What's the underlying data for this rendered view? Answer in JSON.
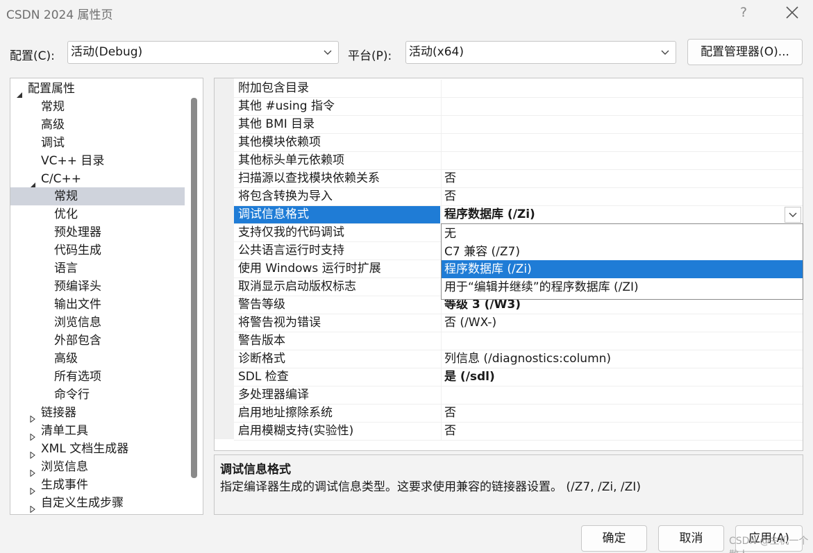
{
  "window": {
    "title": "CSDN 2024 属性页",
    "help": "?"
  },
  "toolbar": {
    "config_label": "配置(C):",
    "config_value": "活动(Debug)",
    "platform_label": "平台(P):",
    "platform_value": "活动(x64)",
    "config_manager": "配置管理器(O)..."
  },
  "tree": {
    "items": [
      {
        "label": "配置属性"
      },
      {
        "label": "常规"
      },
      {
        "label": "高级"
      },
      {
        "label": "调试"
      },
      {
        "label": "VC++ 目录"
      },
      {
        "label": "C/C++"
      },
      {
        "label": "常规"
      },
      {
        "label": "优化"
      },
      {
        "label": "预处理器"
      },
      {
        "label": "代码生成"
      },
      {
        "label": "语言"
      },
      {
        "label": "预编译头"
      },
      {
        "label": "输出文件"
      },
      {
        "label": "浏览信息"
      },
      {
        "label": "外部包含"
      },
      {
        "label": "高级"
      },
      {
        "label": "所有选项"
      },
      {
        "label": "命令行"
      },
      {
        "label": "链接器"
      },
      {
        "label": "清单工具"
      },
      {
        "label": "XML 文档生成器"
      },
      {
        "label": "浏览信息"
      },
      {
        "label": "生成事件"
      },
      {
        "label": "自定义生成步骤"
      }
    ]
  },
  "properties": [
    {
      "name": "附加包含目录",
      "value": ""
    },
    {
      "name": "其他 #using 指令",
      "value": ""
    },
    {
      "name": "其他 BMI 目录",
      "value": ""
    },
    {
      "name": "其他模块依赖项",
      "value": ""
    },
    {
      "name": "其他标头单元依赖项",
      "value": ""
    },
    {
      "name": "扫描源以查找模块依赖关系",
      "value": "否"
    },
    {
      "name": "将包含转换为导入",
      "value": "否"
    },
    {
      "name": "调试信息格式",
      "value": "程序数据库 (/Zi)"
    },
    {
      "name": "支持仅我的代码调试",
      "value": ""
    },
    {
      "name": "公共语言运行时支持",
      "value": ""
    },
    {
      "name": "使用 Windows 运行时扩展",
      "value": ""
    },
    {
      "name": "取消显示启动版权标志",
      "value": ""
    },
    {
      "name": "警告等级",
      "value": "等级 3 (/W3)"
    },
    {
      "name": "将警告视为错误",
      "value": "否 (/WX-)"
    },
    {
      "name": "警告版本",
      "value": ""
    },
    {
      "name": "诊断格式",
      "value": "列信息 (/diagnostics:column)"
    },
    {
      "name": "SDL 检查",
      "value": "是 (/sdl)"
    },
    {
      "name": "多处理器编译",
      "value": ""
    },
    {
      "name": "启用地址擦除系统",
      "value": "否"
    },
    {
      "name": "启用模糊支持(实验性)",
      "value": "否"
    }
  ],
  "dropdown": {
    "options": [
      {
        "label": "无"
      },
      {
        "label": "C7 兼容 (/Z7)"
      },
      {
        "label": "程序数据库 (/Zi)"
      },
      {
        "label": "用于“编辑并继续”的程序数据库 (/ZI)"
      }
    ]
  },
  "description": {
    "title": "调试信息格式",
    "text": "指定编译器生成的调试信息类型。这要求使用兼容的链接器设置。  (/Z7, /Zi, /ZI)"
  },
  "buttons": {
    "ok": "确定",
    "cancel": "取消",
    "apply": "应用(A)"
  },
  "watermark": "CSDN @主机一个散人",
  "colors": {
    "selection": "#1f7cd6",
    "tree_selection": "#cfd3dc"
  }
}
